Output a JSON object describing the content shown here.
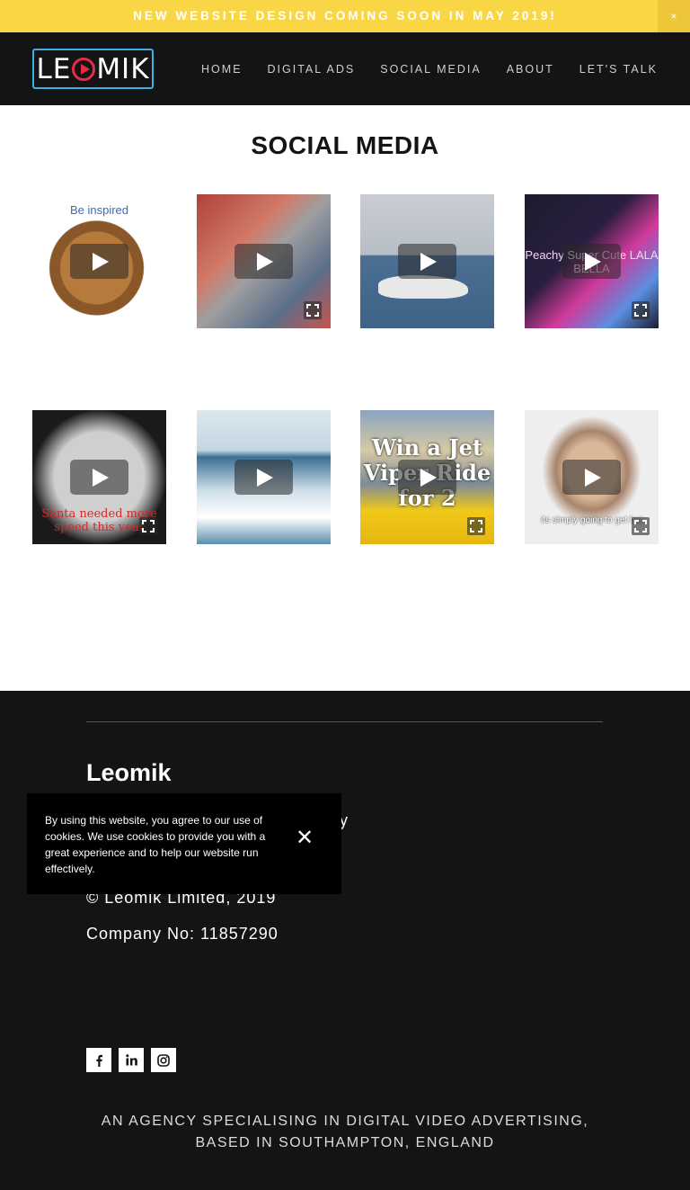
{
  "announcement": {
    "text": "NEW WEBSITE DESIGN COMING SOON IN MAY 2019!",
    "close_label": "×"
  },
  "header": {
    "logo_text_left": "LE",
    "logo_text_right": "MIK",
    "nav": [
      {
        "label": "HOME"
      },
      {
        "label": "DIGITAL ADS"
      },
      {
        "label": "SOCIAL MEDIA"
      },
      {
        "label": "ABOUT"
      },
      {
        "label": "LET'S TALK"
      }
    ]
  },
  "page": {
    "title": "SOCIAL MEDIA"
  },
  "tiles": [
    {
      "caption": "Be inspired"
    },
    {
      "caption": ""
    },
    {
      "caption": ""
    },
    {
      "caption": "Peachy  Super Cute  LALA BELLA"
    },
    {
      "caption": "Santa needed more speed this year"
    },
    {
      "caption": ""
    },
    {
      "caption": "Win a Jet Viper Ride for 2"
    },
    {
      "caption": "its simply going to get bet"
    }
  ],
  "cookie": {
    "text": "By using this website, you agree to our use of cookies. We use cookies to provide you with a great experience and to help our website run effectively.",
    "close_label": "✕"
  },
  "footer": {
    "brand": "Leomik",
    "link_partial": "y",
    "copyright": "© Leomik Limited, 2019",
    "company": "Company No: 11857290",
    "tagline_line1": "AN AGENCY SPECIALISING IN DIGITAL VIDEO ADVERTISING,",
    "tagline_line2": "BASED IN SOUTHAMPTON, ENGLAND",
    "socials": [
      "facebook-icon",
      "linkedin-icon",
      "instagram-icon"
    ]
  },
  "colors": {
    "announcement_bg": "#f9d646",
    "header_bg": "#141414",
    "logo_border": "#3fb0e3",
    "logo_play": "#e62c46"
  }
}
